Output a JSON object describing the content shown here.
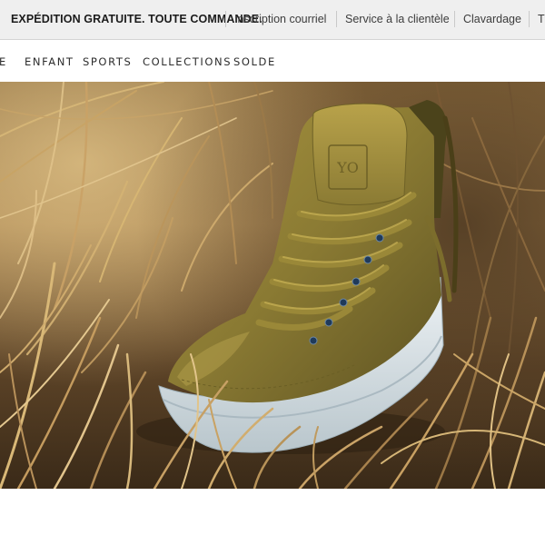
{
  "topbar": {
    "promo": "EXPÉDITION GRATUITE. TOUTE COMMANDE.",
    "links": [
      "Inscription courriel",
      "Service à la clientèle",
      "Clavardage",
      "Tr"
    ]
  },
  "nav": {
    "items": [
      "E",
      "ENFANT",
      "SPORTS",
      "COLLECTIONS",
      "SOLDE"
    ]
  },
  "hero": {
    "subject": "olive suede high-top sneaker in dry grass",
    "tongue_logo_text": "YO"
  },
  "colors": {
    "topbar_bg": "#efefef",
    "shoe_suede": "#8a7a33",
    "sole": "#dfe6ea",
    "grass_light": "#d9b877",
    "grass_dark": "#3a2a18"
  }
}
